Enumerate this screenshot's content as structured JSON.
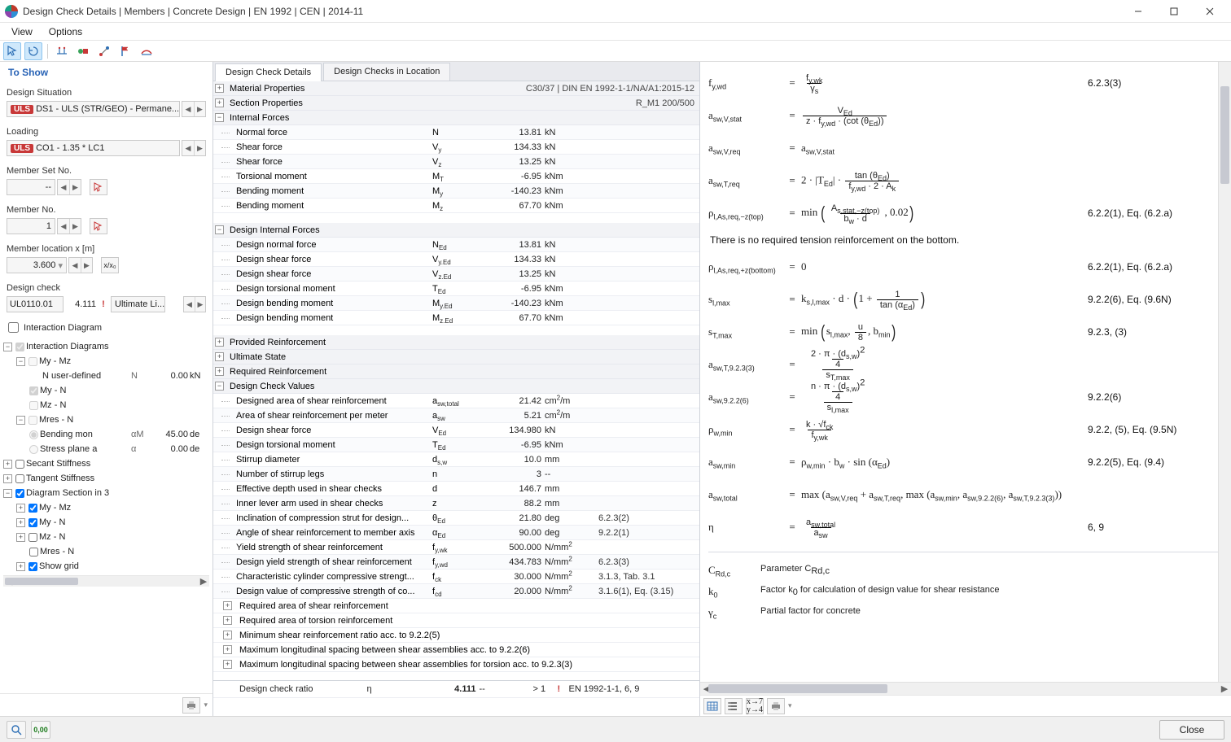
{
  "window": {
    "title": "Design Check Details | Members | Concrete Design | EN 1992 | CEN | 2014-11"
  },
  "menu": {
    "view": "View",
    "options": "Options"
  },
  "left": {
    "header": "To Show",
    "design_situation_label": "Design Situation",
    "design_situation_value": "DS1 - ULS (STR/GEO) - Permane...",
    "loading_label": "Loading",
    "loading_value": "CO1 - 1.35 * LC1",
    "member_set_label": "Member Set No.",
    "member_set_value": "--",
    "member_no_label": "Member No.",
    "member_no_value": "1",
    "location_label": "Member location x [m]",
    "location_value": "3.600",
    "xx0": "x/x₀",
    "design_check_label": "Design check",
    "design_check_code": "UL0110.01",
    "design_check_ratio": "4.111",
    "design_check_type": "Ultimate Li...",
    "interaction_label": "Interaction Diagram",
    "tree": {
      "interaction": "Interaction Diagrams",
      "my_mz": "My - Mz",
      "n_user": "N user-defined",
      "n_user_sym": "N",
      "n_user_val": "0.00",
      "n_user_unit": "kN",
      "my_n": "My - N",
      "mz_n": "Mz - N",
      "mres_n": "Mres - N",
      "bending_ax": "Bending mon",
      "bending_sym": "αM",
      "bending_val": "45.00",
      "bending_unit": "de",
      "stress_pl": "Stress plane a",
      "stress_sym": "α",
      "stress_val": "0.00",
      "stress_unit": "de",
      "secant": "Secant Stiffness",
      "tangent": "Tangent Stiffness",
      "sec3d": "Diagram Section in 3",
      "show_grid": "Show grid"
    }
  },
  "tabs": {
    "t1": "Design Check Details",
    "t2": "Design Checks in Location"
  },
  "mid": {
    "mat_props": "Material Properties",
    "mat_right": "C30/37 | DIN EN 1992-1-1/NA/A1:2015-12",
    "sec_props": "Section Properties",
    "sec_right": "R_M1 200/500",
    "internal_forces": "Internal Forces",
    "design_internal": "Design Internal Forces",
    "provided": "Provided Reinforcement",
    "ultimate": "Ultimate State",
    "required_reinf": "Required Reinforcement",
    "design_values": "Design Check Values",
    "sub1": "Required area of shear reinforcement",
    "sub2": "Required area of torsion reinforcement",
    "sub3": "Minimum shear reinforcement ratio acc. to 9.2.2(5)",
    "sub4": "Maximum longitudinal spacing between shear assemblies acc. to 9.2.2(6)",
    "sub5": "Maximum longitudinal spacing between shear assemblies for torsion acc. to 9.2.3(3)",
    "ratio_label": "Design check ratio",
    "ratio_sym": "η",
    "ratio_val": "4.111",
    "ratio_unit": "--",
    "ratio_cmp": "> 1",
    "ratio_std": "EN 1992-1-1, 6, 9",
    "if": [
      {
        "name": "Normal force",
        "sym": "N",
        "val": "13.81",
        "unit": "kN",
        "ref": ""
      },
      {
        "name": "Shear force",
        "sym": "V<sub>y</sub>",
        "val": "134.33",
        "unit": "kN",
        "ref": ""
      },
      {
        "name": "Shear force",
        "sym": "V<sub>z</sub>",
        "val": "13.25",
        "unit": "kN",
        "ref": ""
      },
      {
        "name": "Torsional moment",
        "sym": "M<sub>T</sub>",
        "val": "-6.95",
        "unit": "kNm",
        "ref": ""
      },
      {
        "name": "Bending moment",
        "sym": "M<sub>y</sub>",
        "val": "-140.23",
        "unit": "kNm",
        "ref": ""
      },
      {
        "name": "Bending moment",
        "sym": "M<sub>z</sub>",
        "val": "67.70",
        "unit": "kNm",
        "ref": ""
      }
    ],
    "dif": [
      {
        "name": "Design normal force",
        "sym": "N<sub>Ed</sub>",
        "val": "13.81",
        "unit": "kN",
        "ref": ""
      },
      {
        "name": "Design shear force",
        "sym": "V<sub>y.Ed</sub>",
        "val": "134.33",
        "unit": "kN",
        "ref": ""
      },
      {
        "name": "Design shear force",
        "sym": "V<sub>z.Ed</sub>",
        "val": "13.25",
        "unit": "kN",
        "ref": ""
      },
      {
        "name": "Design torsional moment",
        "sym": "T<sub>Ed</sub>",
        "val": "-6.95",
        "unit": "kNm",
        "ref": ""
      },
      {
        "name": "Design bending moment",
        "sym": "M<sub>y.Ed</sub>",
        "val": "-140.23",
        "unit": "kNm",
        "ref": ""
      },
      {
        "name": "Design bending moment",
        "sym": "M<sub>z.Ed</sub>",
        "val": "67.70",
        "unit": "kNm",
        "ref": ""
      }
    ],
    "dcv": [
      {
        "name": "Designed area of shear reinforcement",
        "sym": "a<sub>sw,total</sub>",
        "val": "21.42",
        "unit": "cm<sup>2</sup>/m",
        "ref": ""
      },
      {
        "name": "Area of shear reinforcement per meter",
        "sym": "a<sub>sw</sub>",
        "val": "5.21",
        "unit": "cm<sup>2</sup>/m",
        "ref": ""
      },
      {
        "name": "Design shear force",
        "sym": "V<sub>Ed</sub>",
        "val": "134.980",
        "unit": "kN",
        "ref": ""
      },
      {
        "name": "Design torsional moment",
        "sym": "T<sub>Ed</sub>",
        "val": "-6.95",
        "unit": "kNm",
        "ref": ""
      },
      {
        "name": "Stirrup diameter",
        "sym": "d<sub>s,w</sub>",
        "val": "10.0",
        "unit": "mm",
        "ref": ""
      },
      {
        "name": "Number of stirrup legs",
        "sym": "n",
        "val": "3",
        "unit": "--",
        "ref": ""
      },
      {
        "name": "Effective depth used in shear checks",
        "sym": "d",
        "val": "146.7",
        "unit": "mm",
        "ref": ""
      },
      {
        "name": "Inner lever arm used in shear checks",
        "sym": "z",
        "val": "88.2",
        "unit": "mm",
        "ref": ""
      },
      {
        "name": "Inclination of compression strut for design...",
        "sym": "θ<sub>Ed</sub>",
        "val": "21.80",
        "unit": "deg",
        "ref": "6.2.3(2)"
      },
      {
        "name": "Angle of shear reinforcement to member axis",
        "sym": "α<sub>Ed</sub>",
        "val": "90.00",
        "unit": "deg",
        "ref": "9.2.2(1)"
      },
      {
        "name": "Yield strength of shear reinforcement",
        "sym": "f<sub>y,wk</sub>",
        "val": "500.000",
        "unit": "N/mm<sup>2</sup>",
        "ref": ""
      },
      {
        "name": "Design yield strength of shear reinforcement",
        "sym": "f<sub>y,wd</sub>",
        "val": "434.783",
        "unit": "N/mm<sup>2</sup>",
        "ref": "6.2.3(3)"
      },
      {
        "name": "Characteristic cylinder compressive strengt...",
        "sym": "f<sub>ck</sub>",
        "val": "30.000",
        "unit": "N/mm<sup>2</sup>",
        "ref": "3.1.3, Tab. 3.1"
      },
      {
        "name": "Design value of compressive strength of co...",
        "sym": "f<sub>cd</sub>",
        "val": "20.000",
        "unit": "N/mm<sup>2</sup>",
        "ref": "3.1.6(1), Eq. (3.15)"
      }
    ]
  },
  "right": {
    "eqs": [
      {
        "lhs": "f<sub>y,wd</sub>",
        "rhs": "<span class='frac'><span class='num1'>f<sub>y,wk</sub></span><span class='den'>γ<sub>s</sub></span></span>",
        "ref": "6.2.3(3)"
      },
      {
        "lhs": "a<sub>sw,V,stat</sub>",
        "rhs": "<span class='frac'><span class='num1'>V<sub>Ed</sub></span><span class='den'>z · f<sub>y,wd</sub> · (cot (θ<sub>Ed</sub>))</span></span>",
        "ref": ""
      },
      {
        "lhs": "a<sub>sw,V,req</sub>",
        "rhs": "a<sub>sw,V,stat</sub>",
        "ref": ""
      },
      {
        "lhs": "a<sub>sw,T,req</sub>",
        "rhs": "2 · |T<sub>Ed</sub>| · <span class='frac'><span class='num1'>tan (θ<sub>Ed</sub>)</span><span class='den'>f<sub>y,wd</sub> · 2 · A<sub>k</sub></span></span>",
        "ref": ""
      },
      {
        "lhs": "ρ<sub>l,As,req,−z(top)</sub>",
        "rhs": "min <span class='bigparen'>(</span><span class='frac'><span class='num1'>A<sub>s,stat,−z(top)</sub></span><span class='den'>b<sub>w</sub> · d</span></span>, 0.02<span class='bigparen'>)</span>",
        "ref": "6.2.2(1), Eq. (6.2.a)"
      }
    ],
    "note": "There is no required tension reinforcement on the bottom.",
    "eqs2": [
      {
        "lhs": "ρ<sub>l,As,req,+z(bottom)</sub>",
        "rhs": "0",
        "ref": "6.2.2(1), Eq. (6.2.a)"
      },
      {
        "lhs": "s<sub>l,max</sub>",
        "rhs": "k<sub>s,l,max</sub> · d · <span class='bigparen'>(</span>1 + <span class='frac'><span class='num1'>1</span><span class='den'>tan (α<sub>Ed</sub>)</span></span><span class='bigparen'>)</span>",
        "ref": "9.2.2(6), Eq. (9.6N)"
      },
      {
        "lhs": "s<sub>T,max</sub>",
        "rhs": "min <span class='bigparen'>(</span>s<sub>l,max</sub>, <span class='frac'><span class='num1'>u</span><span class='den'>8</span></span>, b<sub>min</sub><span class='bigparen'>)</span>",
        "ref": "9.2.3, (3)"
      },
      {
        "lhs": "a<sub>sw,T,9.2.3(3)</sub>",
        "rhs": "<span class='frac'><span class='num1'><span class='frac'><span class='num1'>2 · π · (d<sub>s,w</sub>)<sup>2</sup></span><span class='den'>4</span></span></span><span class='den'>s<sub>T,max</sub></span></span>",
        "ref": ""
      },
      {
        "lhs": "a<sub>sw,9.2.2(6)</sub>",
        "rhs": "<span class='frac'><span class='num1'><span class='frac'><span class='num1'>n · π · (d<sub>s,w</sub>)<sup>2</sup></span><span class='den'>4</span></span></span><span class='den'>s<sub>l,max</sub></span></span>",
        "ref": "9.2.2(6)"
      },
      {
        "lhs": "ρ<sub>w,min</sub>",
        "rhs": "<span class='frac'><span class='num1'>k · √f<sub>ck</sub></span><span class='den'>f<sub>y,wk</sub></span></span>",
        "ref": "9.2.2, (5), Eq. (9.5N)"
      },
      {
        "lhs": "a<sub>sw,min</sub>",
        "rhs": "ρ<sub>w,min</sub> · b<sub>w</sub> · sin (α<sub>Ed</sub>)",
        "ref": "9.2.2(5), Eq. (9.4)"
      },
      {
        "lhs": "a<sub>sw,total</sub>",
        "rhs": "max (a<sub>sw,V,req</sub> + a<sub>sw,T,req</sub>, max (a<sub>sw,min</sub>, a<sub>sw,9.2.2(6)</sub>, a<sub>sw,T,9.2.3(3)</sub>))",
        "ref": ""
      },
      {
        "lhs": "η",
        "rhs": "<span class='frac'><span class='num1'>a<sub>sw,total</sub></span><span class='den'>a<sub>sw</sub></span></span>",
        "ref": "6, 9"
      }
    ],
    "params": [
      {
        "sym": "C<sub>Rd,c</sub>",
        "desc": "Parameter C<sub>Rd,c</sub>"
      },
      {
        "sym": "k<sub>0</sub>",
        "desc": "Factor k<sub>0</sub> for calculation of design value for shear resistance"
      },
      {
        "sym": "γ<sub>c</sub>",
        "desc": "Partial factor for concrete"
      }
    ]
  },
  "footer": {
    "close": "Close"
  }
}
